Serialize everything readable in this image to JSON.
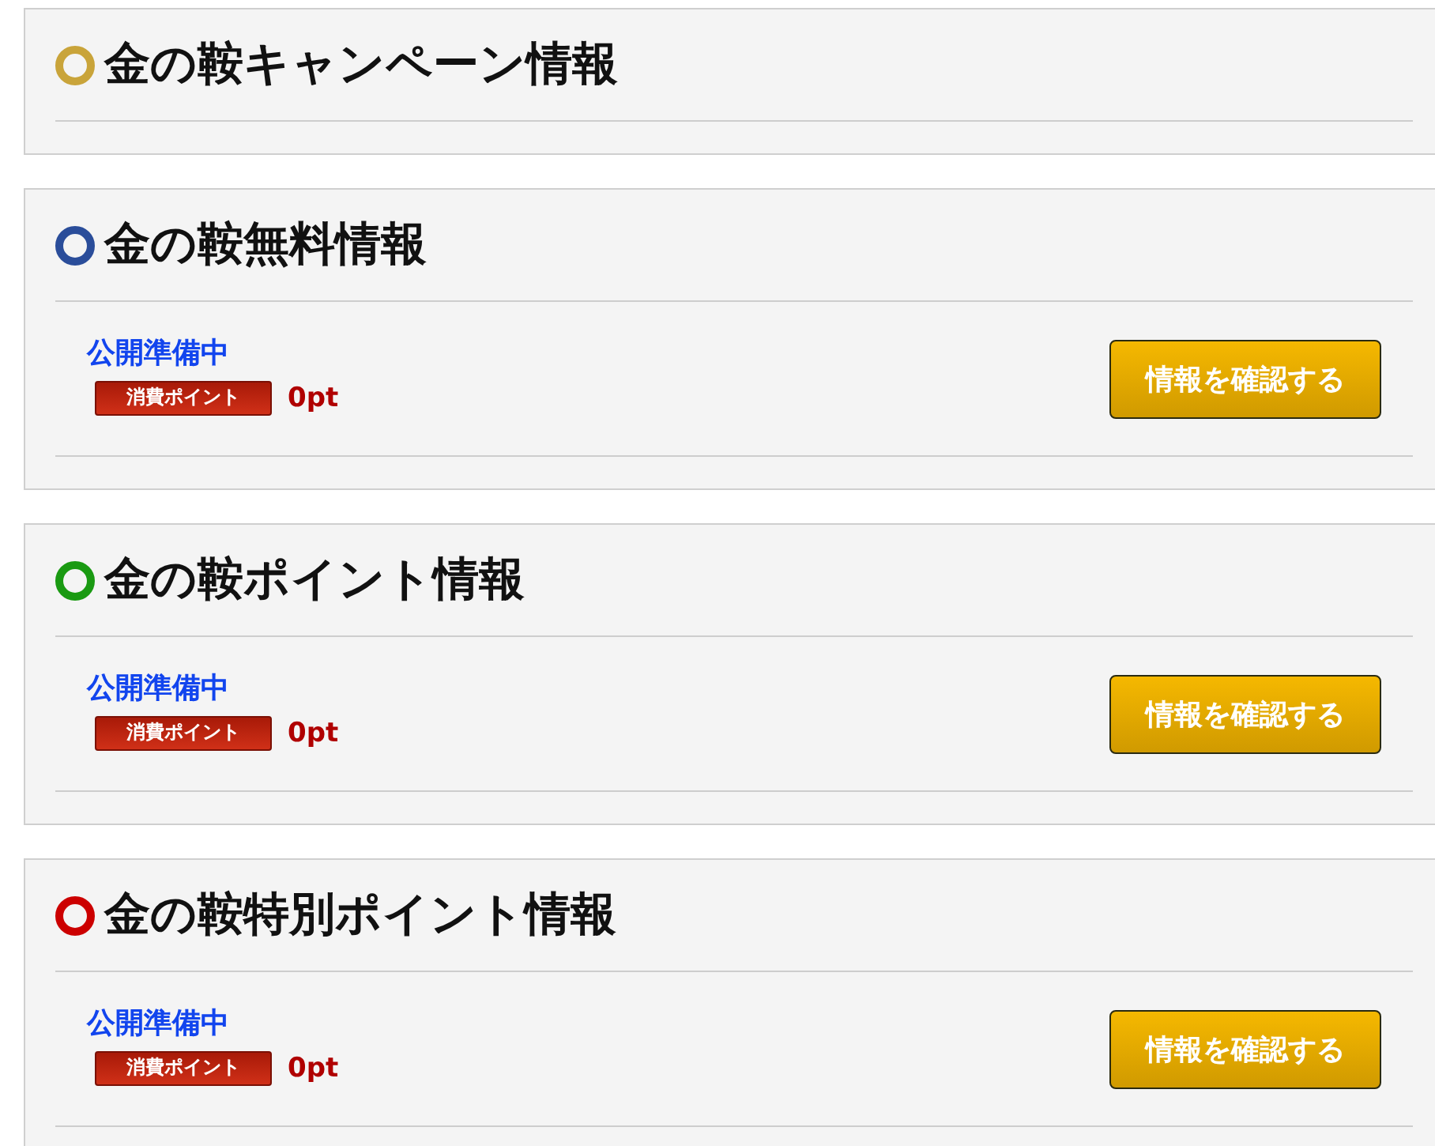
{
  "sections": [
    {
      "title": "金の鞍キャンペーン情報",
      "color": "#c9a43a"
    },
    {
      "title": "金の鞍無料情報",
      "color": "#2a4d9a",
      "items": [
        {
          "status": "公開準備中",
          "badge": "消費ポイント",
          "points": "0pt",
          "button": "情報を確認する"
        }
      ]
    },
    {
      "title": "金の鞍ポイント情報",
      "color": "#1a9a12",
      "items": [
        {
          "status": "公開準備中",
          "badge": "消費ポイント",
          "points": "0pt",
          "button": "情報を確認する"
        }
      ]
    },
    {
      "title": "金の鞍特別ポイント情報",
      "color": "#cc0000",
      "items": [
        {
          "status": "公開準備中",
          "badge": "消費ポイント",
          "points": "0pt",
          "button": "情報を確認する"
        }
      ]
    }
  ]
}
